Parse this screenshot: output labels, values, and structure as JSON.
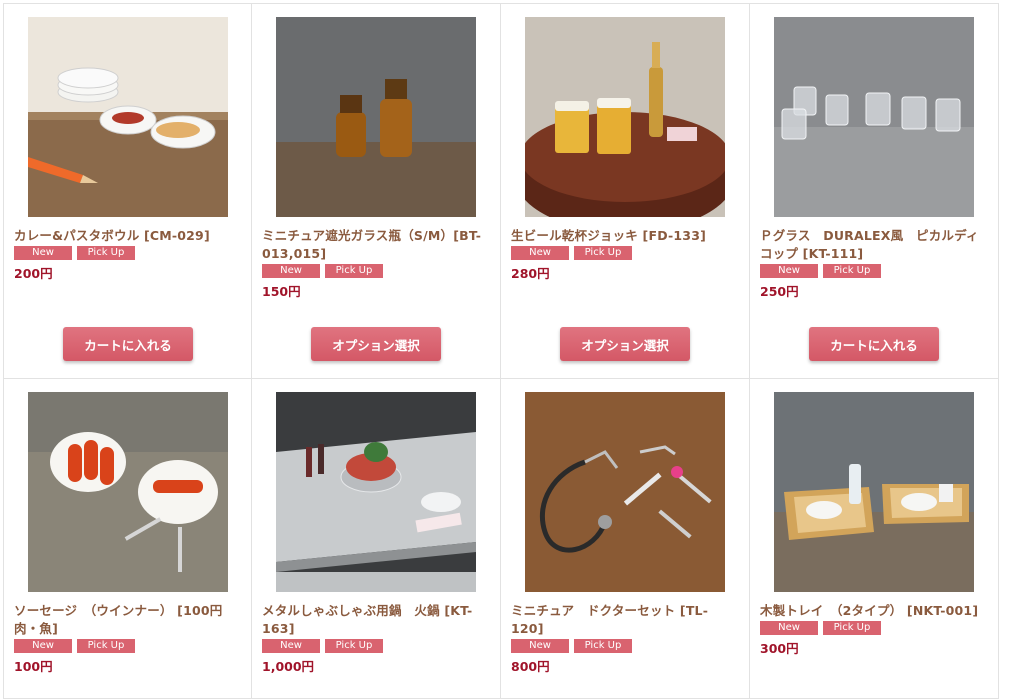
{
  "badges": {
    "new": "New",
    "pickup": "Pick Up"
  },
  "products": [
    {
      "name": "カレー&パスタボウル [CM-029]",
      "price": "200円",
      "button": "カートに入れる"
    },
    {
      "name": "ミニチュア遮光ガラス瓶（S/M）[BT-013,015]",
      "price": "150円",
      "button": "オプション選択"
    },
    {
      "name": "生ビール乾杯ジョッキ [FD-133]",
      "price": "280円",
      "button": "オプション選択"
    },
    {
      "name": "Ｐグラス　DURALEX風　ピカルディ　コップ [KT-111]",
      "price": "250円",
      "button": "カートに入れる"
    },
    {
      "name": "ソーセージ　（ウインナー） [100円 肉・魚]",
      "price": "100円"
    },
    {
      "name": "メタルしゃぶしゃぶ用鍋　火鍋 [KT-163]",
      "price": "1,000円"
    },
    {
      "name": "ミニチュア　ドクターセット [TL-120]",
      "price": "800円"
    },
    {
      "name": "木製トレイ　（2タイプ） [NKT-001]",
      "price": "300円"
    }
  ]
}
